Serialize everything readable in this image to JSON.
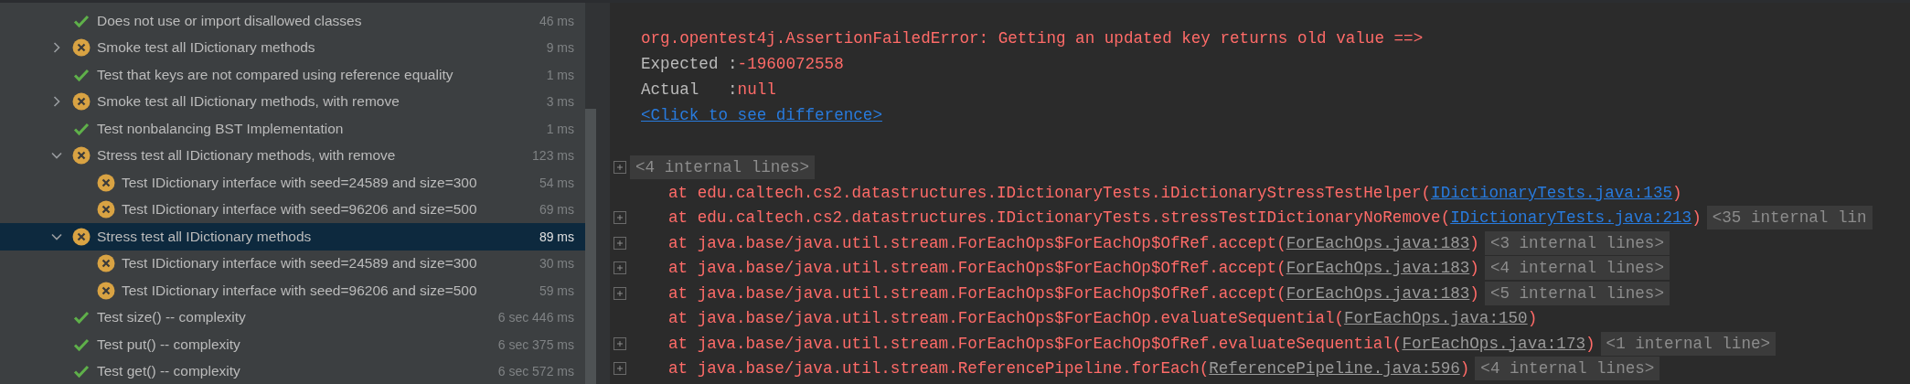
{
  "test_tree": [
    {
      "kind": "passed",
      "name": "Does not use or import disallowed classes",
      "time": "46 ms",
      "selected": false
    },
    {
      "kind": "failed",
      "name": "Smoke test all IDictionary methods",
      "time": "9 ms",
      "selected": false,
      "expanded": false
    },
    {
      "kind": "passed",
      "name": "Test that keys are not compared using reference equality",
      "time": "1 ms",
      "selected": false
    },
    {
      "kind": "failed",
      "name": "Smoke test all IDictionary methods, with remove",
      "time": "3 ms",
      "selected": false,
      "expanded": false
    },
    {
      "kind": "passed",
      "name": "Test nonbalancing BST Implementation",
      "time": "1 ms",
      "selected": false
    },
    {
      "kind": "failed",
      "name": "Stress test all IDictionary methods, with remove",
      "time": "123 ms",
      "selected": false,
      "expanded": true,
      "children": [
        {
          "kind": "failed",
          "name": "Test IDictionary interface with seed=24589 and size=300",
          "time": "54 ms",
          "selected": false
        },
        {
          "kind": "failed",
          "name": "Test IDictionary interface with seed=96206 and size=500",
          "time": "69 ms",
          "selected": false
        }
      ]
    },
    {
      "kind": "failed",
      "name": "Stress test all IDictionary methods",
      "time": "89 ms",
      "selected": true,
      "expanded": true,
      "children": [
        {
          "kind": "failed",
          "name": "Test IDictionary interface with seed=24589 and size=300",
          "time": "30 ms",
          "selected": false
        },
        {
          "kind": "failed",
          "name": "Test IDictionary interface with seed=96206 and size=500",
          "time": "59 ms",
          "selected": false
        }
      ]
    },
    {
      "kind": "passed",
      "name": "Test size() -- complexity",
      "time": "6 sec 446 ms",
      "selected": false
    },
    {
      "kind": "passed",
      "name": "Test put() -- complexity",
      "time": "6 sec 375 ms",
      "selected": false
    },
    {
      "kind": "passed",
      "name": "Test get() -- complexity",
      "time": "6 sec 572 ms",
      "selected": false
    }
  ],
  "console": [
    {
      "kind": "error",
      "text": "org.opentest4j.AssertionFailedError: Getting an updated key returns old value ==>"
    },
    {
      "kind": "value",
      "label": "Expected :",
      "value": "-1960072558"
    },
    {
      "kind": "value",
      "label": "Actual   :",
      "value": "null"
    },
    {
      "kind": "link",
      "text": "<Click to see difference>"
    },
    {
      "kind": "blank"
    },
    {
      "kind": "fold",
      "text": "<4 internal lines>",
      "toggle": true
    },
    {
      "kind": "frame",
      "toggle": false,
      "before": "at edu.caltech.cs2.datastructures.IDictionaryTests.iDictionaryStressTestHelper(",
      "link": "IDictionaryTests.java:135",
      "project_link": true,
      "after": ")"
    },
    {
      "kind": "frame",
      "toggle": true,
      "before": "at edu.caltech.cs2.datastructures.IDictionaryTests.stressTestIDictionaryNoRemove(",
      "link": "IDictionaryTests.java:213",
      "project_link": true,
      "after": ")",
      "folded": "<35 internal lin"
    },
    {
      "kind": "frame",
      "toggle": true,
      "before": "at java.base/java.util.stream.ForEachOps$ForEachOp$OfRef.accept(",
      "link": "ForEachOps.java:183",
      "project_link": false,
      "after": ")",
      "folded": "<3 internal lines>"
    },
    {
      "kind": "frame",
      "toggle": true,
      "before": "at java.base/java.util.stream.ForEachOps$ForEachOp$OfRef.accept(",
      "link": "ForEachOps.java:183",
      "project_link": false,
      "after": ")",
      "folded": "<4 internal lines>"
    },
    {
      "kind": "frame",
      "toggle": true,
      "before": "at java.base/java.util.stream.ForEachOps$ForEachOp$OfRef.accept(",
      "link": "ForEachOps.java:183",
      "project_link": false,
      "after": ")",
      "folded": "<5 internal lines>"
    },
    {
      "kind": "frame",
      "toggle": false,
      "before": "at java.base/java.util.stream.ForEachOps$ForEachOp.evaluateSequential(",
      "link": "ForEachOps.java:150",
      "project_link": false,
      "after": ")"
    },
    {
      "kind": "frame",
      "toggle": true,
      "before": "at java.base/java.util.stream.ForEachOps$ForEachOp$OfRef.evaluateSequential(",
      "link": "ForEachOps.java:173",
      "project_link": false,
      "after": ")",
      "folded": "<1 internal line>"
    },
    {
      "kind": "frame",
      "toggle": true,
      "before": "at java.base/java.util.stream.ReferencePipeline.forEach(",
      "link": "ReferencePipeline.java:596",
      "project_link": false,
      "after": ")",
      "folded": "<4 internal lines>"
    }
  ]
}
